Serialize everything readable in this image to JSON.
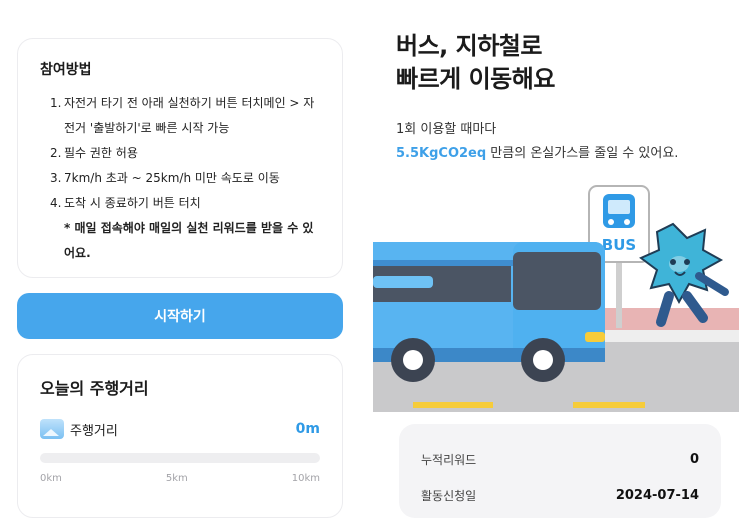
{
  "howto": {
    "title": "참여방법",
    "steps": [
      {
        "num": "1.",
        "text": "자전거 타기 전 아래 실천하기 버튼 터치메인 > 자전거 '출발하기'로 빠른 시작 가능"
      },
      {
        "num": "2.",
        "text": "필수 권한 허용"
      },
      {
        "num": "3.",
        "text": "7km/h 초과 ~ 25km/h 미만 속도로 이동"
      },
      {
        "num": "4.",
        "text": "도착 시 종료하기 버튼 터치"
      }
    ],
    "note": "* 매일 접속해야 매일의 실천 리워드를 받을 수 있어요."
  },
  "start_button": "시작하기",
  "distance": {
    "title": "오늘의 주행거리",
    "label": "주행거리",
    "value": "0m",
    "progress": 0,
    "ticks": [
      "0km",
      "5km",
      "10km"
    ]
  },
  "promo": {
    "headline_line1": "버스, 지하철로",
    "headline_line2": "빠르게 이동해요",
    "sub_line1": "1회 이용할 때마다",
    "highlight": "5.5KgCO2eq",
    "sub_line2_rest": " 만큼의 온실가스를 줄일 수 있어요.",
    "bus_sign": "BUS"
  },
  "summary": {
    "reward_label": "누적리워드",
    "reward_value": "0",
    "date_label": "활동신청일",
    "date_value": "2024-07-14"
  },
  "colors": {
    "accent": "#46a6ec",
    "highlight_text": "#3ea0e8",
    "bus_body": "#4eaef0",
    "character": "#3fb4d8"
  }
}
